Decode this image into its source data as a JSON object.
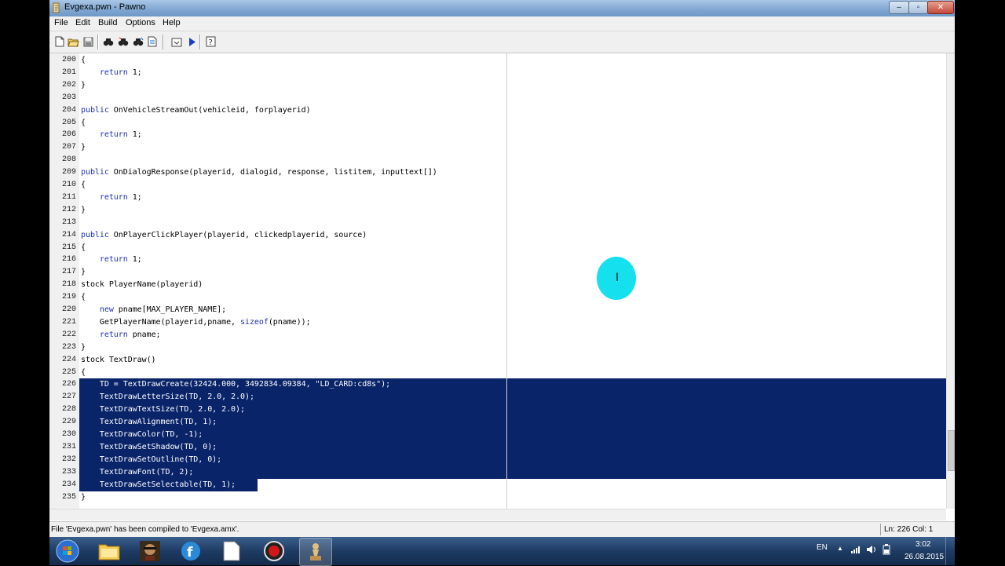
{
  "window": {
    "title": "Evgexa.pwn - Pawno",
    "controls": {
      "minimize": "–",
      "maximize": "▫",
      "close": "✕"
    }
  },
  "menu": [
    {
      "label": "File"
    },
    {
      "label": "Edit"
    },
    {
      "label": "Build"
    },
    {
      "label": "Options"
    },
    {
      "label": "Help"
    }
  ],
  "toolbar": {
    "icons": [
      "new-file-icon",
      "open-folder-icon",
      "save-icon",
      "find-icon",
      "find-next-icon",
      "replace-icon",
      "goto-line-icon",
      "compile-icon",
      "compile-run-icon",
      "help-icon"
    ]
  },
  "editor": {
    "selection_start": 226,
    "selection_end": 234,
    "lines": [
      {
        "n": "200",
        "segments": [
          {
            "t": "{"
          }
        ]
      },
      {
        "n": "201",
        "segments": [
          {
            "t": "    "
          },
          {
            "t": "return",
            "kw": true
          },
          {
            "t": " 1;"
          }
        ]
      },
      {
        "n": "202",
        "segments": [
          {
            "t": "}"
          }
        ]
      },
      {
        "n": "203",
        "segments": [
          {
            "t": ""
          }
        ]
      },
      {
        "n": "204",
        "segments": [
          {
            "t": "public",
            "kw": true
          },
          {
            "t": " OnVehicleStreamOut(vehicleid, forplayerid)"
          }
        ]
      },
      {
        "n": "205",
        "segments": [
          {
            "t": "{"
          }
        ]
      },
      {
        "n": "206",
        "segments": [
          {
            "t": "    "
          },
          {
            "t": "return",
            "kw": true
          },
          {
            "t": " 1;"
          }
        ]
      },
      {
        "n": "207",
        "segments": [
          {
            "t": "}"
          }
        ]
      },
      {
        "n": "208",
        "segments": [
          {
            "t": ""
          }
        ]
      },
      {
        "n": "209",
        "segments": [
          {
            "t": "public",
            "kw": true
          },
          {
            "t": " OnDialogResponse(playerid, dialogid, response, listitem, inputtext[])"
          }
        ]
      },
      {
        "n": "210",
        "segments": [
          {
            "t": "{"
          }
        ]
      },
      {
        "n": "211",
        "segments": [
          {
            "t": "    "
          },
          {
            "t": "return",
            "kw": true
          },
          {
            "t": " 1;"
          }
        ]
      },
      {
        "n": "212",
        "segments": [
          {
            "t": "}"
          }
        ]
      },
      {
        "n": "213",
        "segments": [
          {
            "t": ""
          }
        ]
      },
      {
        "n": "214",
        "segments": [
          {
            "t": "public",
            "kw": true
          },
          {
            "t": " OnPlayerClickPlayer(playerid, clickedplayerid, source)"
          }
        ]
      },
      {
        "n": "215",
        "segments": [
          {
            "t": "{"
          }
        ]
      },
      {
        "n": "216",
        "segments": [
          {
            "t": "    "
          },
          {
            "t": "return",
            "kw": true
          },
          {
            "t": " 1;"
          }
        ]
      },
      {
        "n": "217",
        "segments": [
          {
            "t": "}"
          }
        ]
      },
      {
        "n": "218",
        "segments": [
          {
            "t": "stock PlayerName(playerid)"
          }
        ]
      },
      {
        "n": "219",
        "segments": [
          {
            "t": "{"
          }
        ]
      },
      {
        "n": "220",
        "segments": [
          {
            "t": "    "
          },
          {
            "t": "new",
            "kw": true
          },
          {
            "t": " pname[MAX_PLAYER_NAME];"
          }
        ]
      },
      {
        "n": "221",
        "segments": [
          {
            "t": "    GetPlayerName(playerid,pname, "
          },
          {
            "t": "sizeof",
            "kw": true
          },
          {
            "t": "(pname));"
          }
        ]
      },
      {
        "n": "222",
        "segments": [
          {
            "t": "    "
          },
          {
            "t": "return",
            "kw": true
          },
          {
            "t": " pname;"
          }
        ]
      },
      {
        "n": "223",
        "segments": [
          {
            "t": "}"
          }
        ]
      },
      {
        "n": "224",
        "segments": [
          {
            "t": "stock TextDraw()"
          }
        ]
      },
      {
        "n": "225",
        "segments": [
          {
            "t": "{"
          }
        ]
      },
      {
        "n": "226",
        "segments": [
          {
            "t": "    TD = TextDrawCreate(32424.000, 3492834.09384, \"LD_CARD:cd8s\");"
          }
        ]
      },
      {
        "n": "227",
        "segments": [
          {
            "t": "    TextDrawLetterSize(TD, 2.0, 2.0);"
          }
        ]
      },
      {
        "n": "228",
        "segments": [
          {
            "t": "    TextDrawTextSize(TD, 2.0, 2.0);"
          }
        ]
      },
      {
        "n": "229",
        "segments": [
          {
            "t": "    TextDrawAlignment(TD, 1);"
          }
        ]
      },
      {
        "n": "230",
        "segments": [
          {
            "t": "    TextDrawColor(TD, -1);"
          }
        ]
      },
      {
        "n": "231",
        "segments": [
          {
            "t": "    TextDrawSetShadow(TD, 0);"
          }
        ]
      },
      {
        "n": "232",
        "segments": [
          {
            "t": "    TextDrawSetOutline(TD, 0);"
          }
        ]
      },
      {
        "n": "233",
        "segments": [
          {
            "t": "    TextDrawFont(TD, 2);"
          }
        ]
      },
      {
        "n": "234",
        "segments": [
          {
            "t": "    TextDrawSetSelectable(TD, 1);"
          }
        ]
      },
      {
        "n": "235",
        "segments": [
          {
            "t": "}"
          }
        ]
      }
    ]
  },
  "status": {
    "message": "File 'Evgexa.pwn' has been compiled to 'Evgexa.amx'.",
    "position": "Ln: 226  Col: 1"
  },
  "taskbar": {
    "language": "EN",
    "time": "3:02",
    "date": "26.08.2015",
    "apps": [
      "start-button",
      "explorer-icon",
      "game-icon",
      "fiddler-icon",
      "blank-document-icon",
      "record-icon",
      "pawno-icon"
    ]
  },
  "colors": {
    "selection": "#0a246a",
    "keyword": "#1f2fb6",
    "cursor_highlight": "#14e0ee"
  }
}
